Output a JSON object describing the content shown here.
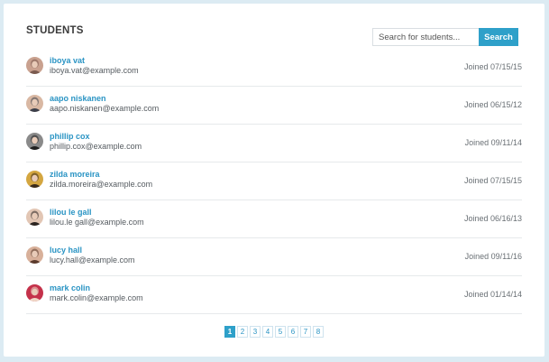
{
  "header": {
    "title": "STUDENTS"
  },
  "search": {
    "placeholder": "Search for students...",
    "button_label": "Search"
  },
  "students": [
    {
      "name": "iboya vat",
      "email": "iboya.vat@example.com",
      "joined": "Joined 07/15/15",
      "avatar_colors": [
        "#c9a18f",
        "#7a5a4f"
      ]
    },
    {
      "name": "aapo niskanen",
      "email": "aapo.niskanen@example.com",
      "joined": "Joined 06/15/12",
      "avatar_colors": [
        "#d9b8a3",
        "#3b3f4a"
      ]
    },
    {
      "name": "phillip cox",
      "email": "phillip.cox@example.com",
      "joined": "Joined 09/11/14",
      "avatar_colors": [
        "#8a8a8a",
        "#1f1f1f"
      ]
    },
    {
      "name": "zilda moreira",
      "email": "zilda.moreira@example.com",
      "joined": "Joined 07/15/15",
      "avatar_colors": [
        "#d4a640",
        "#3a2a1a"
      ]
    },
    {
      "name": "lilou le gall",
      "email": "lilou.le gall@example.com",
      "joined": "Joined 06/16/13",
      "avatar_colors": [
        "#e2c6b4",
        "#2a2320"
      ]
    },
    {
      "name": "lucy hall",
      "email": "lucy.hall@example.com",
      "joined": "Joined 09/11/16",
      "avatar_colors": [
        "#d8b09a",
        "#5a3a2c"
      ]
    },
    {
      "name": "mark colin",
      "email": "mark.colin@example.com",
      "joined": "Joined 01/14/14",
      "avatar_colors": [
        "#c4314a",
        "#f0d8c8"
      ]
    }
  ],
  "pagination": {
    "pages": [
      "1",
      "2",
      "3",
      "4",
      "5",
      "6",
      "7",
      "8"
    ],
    "active": "1"
  },
  "colors": {
    "accent": "#2ea0c9",
    "link": "#2a94c4",
    "page_background": "#dcebf3"
  }
}
